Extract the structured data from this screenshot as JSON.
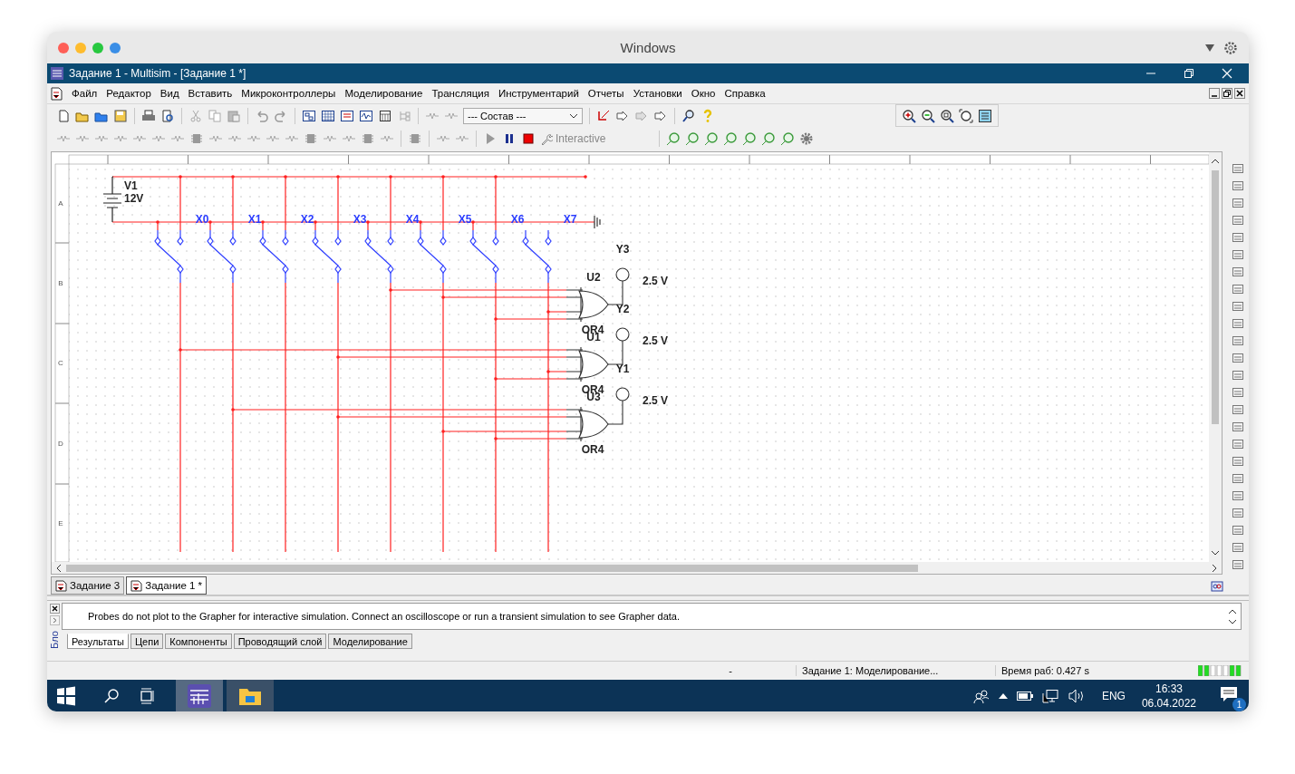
{
  "host_window": {
    "title": "Windows"
  },
  "window": {
    "title": "Задание 1 - Multisim - [Задание 1 *]"
  },
  "menu": [
    "Файл",
    "Редактор",
    "Вид",
    "Вставить",
    "Микроконтроллеры",
    "Моделирование",
    "Трансляция",
    "Инструментарий",
    "Отчеты",
    "Установки",
    "Окно",
    "Справка"
  ],
  "toolbar": {
    "component_list": "--- Состав ---",
    "sim_mode": "Interactive"
  },
  "schematic": {
    "ruler_rows": [
      "A",
      "B",
      "C",
      "D",
      "E"
    ],
    "source": {
      "name": "V1",
      "value": "12V"
    },
    "switches": [
      {
        "label": "X0"
      },
      {
        "label": "X1"
      },
      {
        "label": "X2"
      },
      {
        "label": "X3"
      },
      {
        "label": "X4"
      },
      {
        "label": "X5"
      },
      {
        "label": "X6"
      },
      {
        "label": "X7"
      }
    ],
    "gates": [
      {
        "name": "U2",
        "type": "OR4"
      },
      {
        "name": "U1",
        "type": "OR4"
      },
      {
        "name": "U3",
        "type": "OR4"
      }
    ],
    "probes": [
      {
        "label": "Y3",
        "reading": "2.5 V"
      },
      {
        "label": "Y2",
        "reading": "2.5 V"
      },
      {
        "label": "Y1",
        "reading": "2.5 V"
      }
    ]
  },
  "doc_tabs": [
    {
      "label": "Задание 3",
      "selected": false
    },
    {
      "label": "Задание 1 *",
      "selected": true
    }
  ],
  "output": {
    "panel_label": "Бло",
    "message": "Probes do not plot to the Grapher for interactive simulation. Connect an oscilloscope or run a transient simulation to see Grapher data.",
    "tabs": [
      {
        "label": "Результаты",
        "selected": true
      },
      {
        "label": "Цепи",
        "selected": false
      },
      {
        "label": "Компоненты",
        "selected": false
      },
      {
        "label": "Проводящий слой",
        "selected": false
      },
      {
        "label": "Моделирование",
        "selected": false
      }
    ]
  },
  "status_bar": {
    "field_1": "-",
    "field_2": "Задание 1: Моделирование...",
    "field_3": "Время раб: 0.427 s"
  },
  "taskbar": {
    "language": "ENG",
    "time": "16:33",
    "date": "06.04.2022",
    "notifications": "1"
  }
}
